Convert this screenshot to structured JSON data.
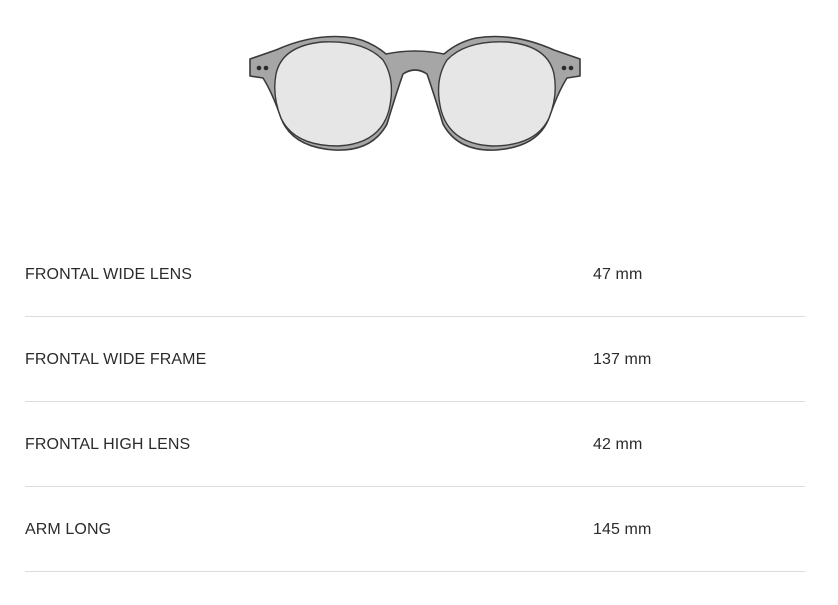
{
  "specs": [
    {
      "label": "FRONTAL WIDE LENS",
      "value": "47 mm"
    },
    {
      "label": "FRONTAL WIDE FRAME",
      "value": "137 mm"
    },
    {
      "label": "FRONTAL HIGH LENS",
      "value": "42 mm"
    },
    {
      "label": "ARM LONG",
      "value": "145 mm"
    }
  ],
  "colors": {
    "frame_fill": "#a6a6a6",
    "frame_stroke": "#3a3a3a",
    "lens_fill": "#e6e6e6",
    "divider": "#dcdcdc",
    "text": "#2b2b2b"
  }
}
